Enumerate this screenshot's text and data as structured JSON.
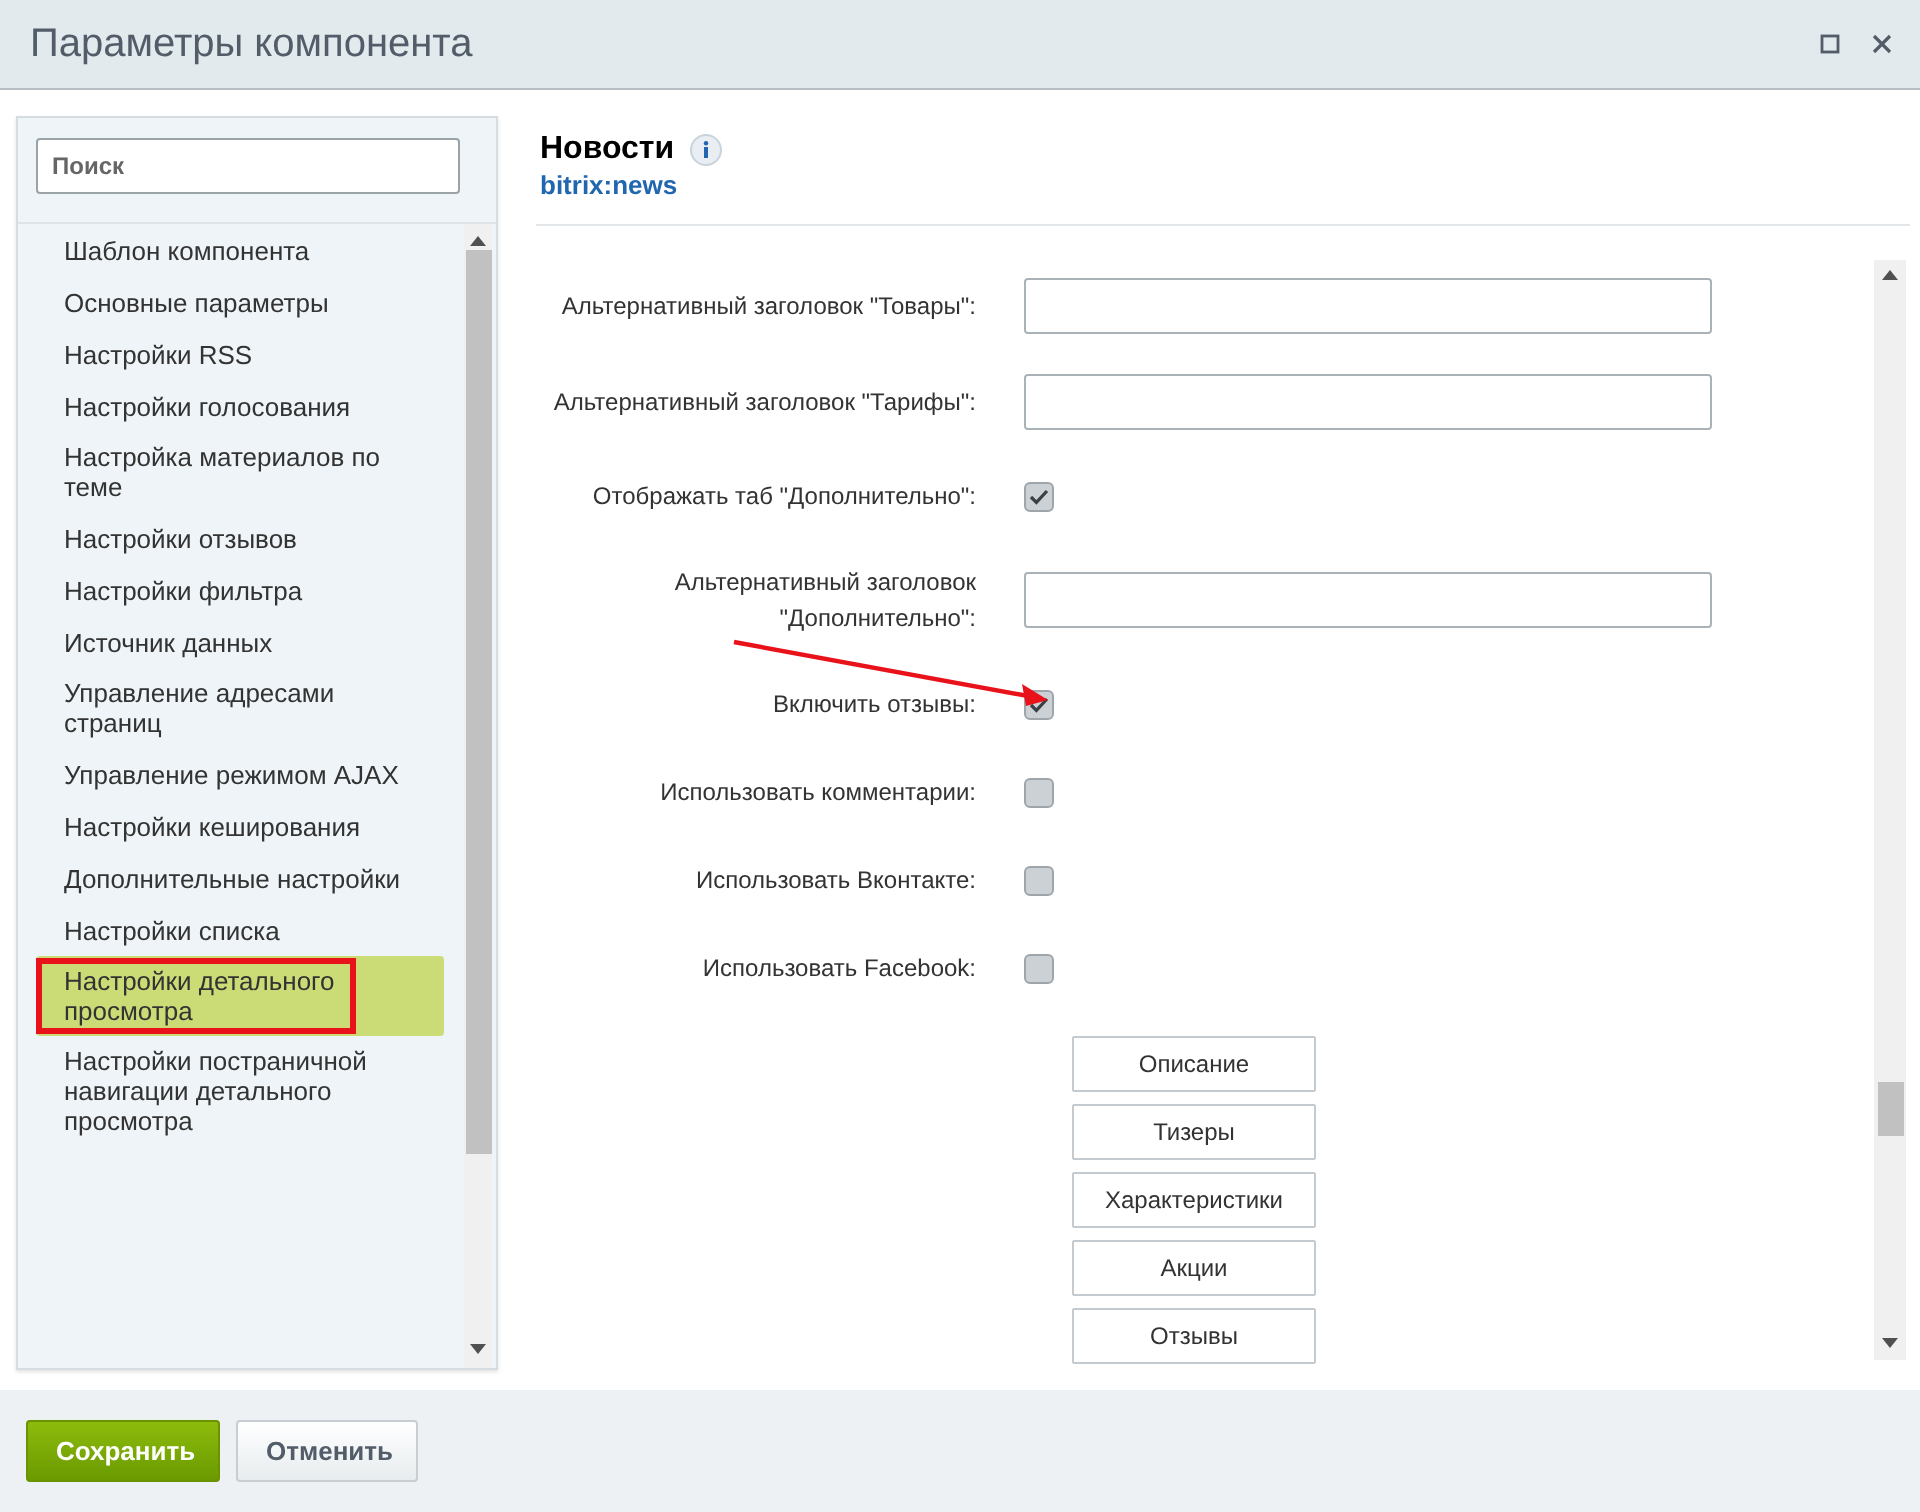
{
  "window": {
    "title": "Параметры компонента"
  },
  "search": {
    "placeholder": "Поиск"
  },
  "sidebar": {
    "items": [
      {
        "label": "Шаблон компонента",
        "selected": false,
        "highlighted": false
      },
      {
        "label": "Основные параметры",
        "selected": false,
        "highlighted": false
      },
      {
        "label": "Настройки RSS",
        "selected": false,
        "highlighted": false
      },
      {
        "label": "Настройки голосования",
        "selected": false,
        "highlighted": false
      },
      {
        "label": "Настройка материалов по теме",
        "selected": false,
        "highlighted": false
      },
      {
        "label": "Настройки отзывов",
        "selected": false,
        "highlighted": false
      },
      {
        "label": "Настройки фильтра",
        "selected": false,
        "highlighted": false
      },
      {
        "label": "Источник данных",
        "selected": false,
        "highlighted": false
      },
      {
        "label": "Управление адресами страниц",
        "selected": false,
        "highlighted": false
      },
      {
        "label": "Управление режимом AJAX",
        "selected": false,
        "highlighted": false
      },
      {
        "label": "Настройки кеширования",
        "selected": false,
        "highlighted": false
      },
      {
        "label": "Дополнительные настройки",
        "selected": false,
        "highlighted": false
      },
      {
        "label": "Настройки списка",
        "selected": false,
        "highlighted": false
      },
      {
        "label": "Настройки детального просмотра",
        "selected": true,
        "highlighted": true
      },
      {
        "label": "Настройки постраничной навигации детального просмотра",
        "selected": false,
        "highlighted": false
      }
    ]
  },
  "component": {
    "name": "Новости",
    "code": "bitrix:news"
  },
  "fields": [
    {
      "kind": "text",
      "label": "Альтернативный заголовок \"Товары\":",
      "annotated": false
    },
    {
      "kind": "text",
      "label": "Альтернативный заголовок \"Тарифы\":",
      "annotated": false
    },
    {
      "kind": "checkbox",
      "label": "Отображать таб \"Дополнительно\":",
      "checked": true,
      "annotated": false
    },
    {
      "kind": "text",
      "label": "Альтернативный заголовок \"Дополнительно\":",
      "annotated": false
    },
    {
      "kind": "checkbox",
      "label": "Включить отзывы:",
      "checked": true,
      "annotated": true
    },
    {
      "kind": "checkbox",
      "label": "Использовать комментарии:",
      "checked": false,
      "annotated": false
    },
    {
      "kind": "checkbox",
      "label": "Использовать Вконтакте:",
      "checked": false,
      "annotated": false
    },
    {
      "kind": "checkbox",
      "label": "Использовать Facebook:",
      "checked": false,
      "annotated": false
    }
  ],
  "section_buttons": [
    "Описание",
    "Тизеры",
    "Характеристики",
    "Акции",
    "Отзывы"
  ],
  "footer_buttons": [
    {
      "label": "Сохранить",
      "kind": "primary"
    },
    {
      "label": "Отменить",
      "kind": "secondary"
    }
  ]
}
